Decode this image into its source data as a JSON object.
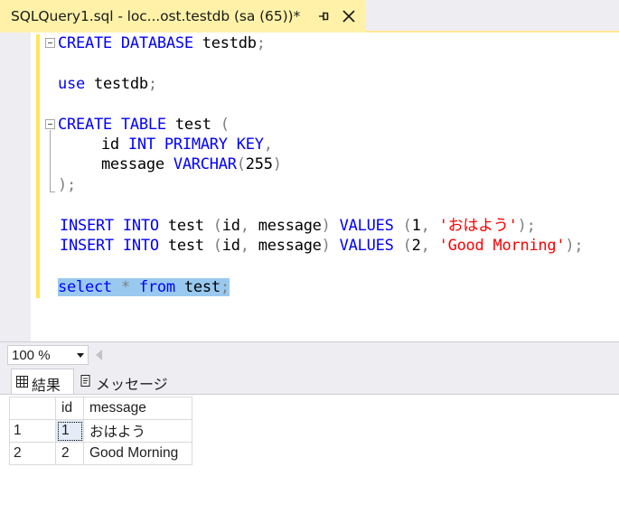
{
  "tab": {
    "title": "SQLQuery1.sql - loc...ost.testdb (sa (65))*",
    "pin_icon": "pin-icon",
    "close_icon": "close-icon"
  },
  "editor": {
    "lines": [
      {
        "tokens": [
          {
            "t": "CREATE",
            "c": "kw"
          },
          {
            "t": " ",
            "c": ""
          },
          {
            "t": "DATABASE",
            "c": "kw"
          },
          {
            "t": " testdb",
            "c": ""
          },
          {
            "t": ";",
            "c": "gray"
          }
        ]
      },
      {
        "tokens": [
          {
            "t": "use",
            "c": "kw"
          },
          {
            "t": " testdb",
            "c": ""
          },
          {
            "t": ";",
            "c": "gray"
          }
        ]
      },
      {
        "tokens": [
          {
            "t": "CREATE",
            "c": "kw"
          },
          {
            "t": " ",
            "c": ""
          },
          {
            "t": "TABLE",
            "c": "kw"
          },
          {
            "t": " test ",
            "c": ""
          },
          {
            "t": "(",
            "c": "gray"
          }
        ]
      },
      {
        "tokens": [
          {
            "t": "    id ",
            "c": ""
          },
          {
            "t": "INT",
            "c": "kw"
          },
          {
            "t": " ",
            "c": ""
          },
          {
            "t": "PRIMARY",
            "c": "kw"
          },
          {
            "t": " ",
            "c": ""
          },
          {
            "t": "KEY",
            "c": "kw"
          },
          {
            "t": ",",
            "c": "gray"
          }
        ]
      },
      {
        "tokens": [
          {
            "t": "    message ",
            "c": ""
          },
          {
            "t": "VARCHAR",
            "c": "kw"
          },
          {
            "t": "(",
            "c": "gray"
          },
          {
            "t": "255",
            "c": ""
          },
          {
            "t": ")",
            "c": "gray"
          }
        ]
      },
      {
        "tokens": [
          {
            "t": ");",
            "c": "gray"
          }
        ]
      },
      {
        "tokens": [
          {
            "t": "INSERT",
            "c": "kw"
          },
          {
            "t": " ",
            "c": ""
          },
          {
            "t": "INTO",
            "c": "kw"
          },
          {
            "t": " test ",
            "c": ""
          },
          {
            "t": "(",
            "c": "gray"
          },
          {
            "t": "id",
            "c": ""
          },
          {
            "t": ",",
            "c": "gray"
          },
          {
            "t": " message",
            "c": ""
          },
          {
            "t": ")",
            "c": "gray"
          },
          {
            "t": " ",
            "c": ""
          },
          {
            "t": "VALUES",
            "c": "kw"
          },
          {
            "t": " ",
            "c": ""
          },
          {
            "t": "(",
            "c": "gray"
          },
          {
            "t": "1",
            "c": ""
          },
          {
            "t": ",",
            "c": "gray"
          },
          {
            "t": " ",
            "c": ""
          },
          {
            "t": "'おはよう'",
            "c": "str"
          },
          {
            "t": ");",
            "c": "gray"
          }
        ]
      },
      {
        "tokens": [
          {
            "t": "INSERT",
            "c": "kw"
          },
          {
            "t": " ",
            "c": ""
          },
          {
            "t": "INTO",
            "c": "kw"
          },
          {
            "t": " test ",
            "c": ""
          },
          {
            "t": "(",
            "c": "gray"
          },
          {
            "t": "id",
            "c": ""
          },
          {
            "t": ",",
            "c": "gray"
          },
          {
            "t": " message",
            "c": ""
          },
          {
            "t": ")",
            "c": "gray"
          },
          {
            "t": " ",
            "c": ""
          },
          {
            "t": "VALUES",
            "c": "kw"
          },
          {
            "t": " ",
            "c": ""
          },
          {
            "t": "(",
            "c": "gray"
          },
          {
            "t": "2",
            "c": ""
          },
          {
            "t": ",",
            "c": "gray"
          },
          {
            "t": " ",
            "c": ""
          },
          {
            "t": "'Good Morning'",
            "c": "str"
          },
          {
            "t": ");",
            "c": "gray"
          }
        ]
      },
      {
        "tokens": [
          {
            "t": "select",
            "c": "kw"
          },
          {
            "t": " ",
            "c": ""
          },
          {
            "t": "*",
            "c": "gray"
          },
          {
            "t": " ",
            "c": ""
          },
          {
            "t": "from",
            "c": "kw"
          },
          {
            "t": " test",
            "c": ""
          },
          {
            "t": ";",
            "c": "gray"
          }
        ],
        "selected": true
      }
    ]
  },
  "zoom": {
    "value": "100 %"
  },
  "results_tabs": [
    {
      "label": "結果",
      "icon": "grid-icon",
      "active": true
    },
    {
      "label": "メッセージ",
      "icon": "message-icon",
      "active": false
    }
  ],
  "grid": {
    "columns": [
      "id",
      "message"
    ],
    "rows": [
      {
        "rownum": "1",
        "id": "1",
        "message": "おはよう"
      },
      {
        "rownum": "2",
        "id": "2",
        "message": "Good Morning"
      }
    ]
  },
  "colors": {
    "keyword": "#0000ff",
    "string": "#ff0000",
    "operator": "#808080",
    "tab_active": "#fff2a8",
    "selection": "#99c9ef"
  }
}
